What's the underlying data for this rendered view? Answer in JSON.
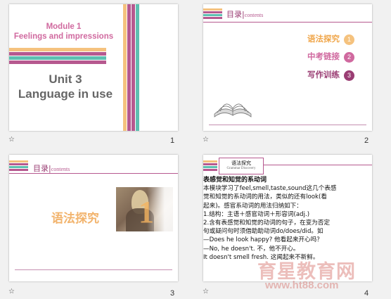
{
  "colors": {
    "orange": "#f5c27e",
    "pink": "#b6598f",
    "teal": "#5ebfb1",
    "purple": "#9a3d73",
    "gray": "#666666"
  },
  "slides": [
    {
      "number": "1",
      "icon": "star-icon",
      "module": "Module 1",
      "subtitle": "Feelings and impressions",
      "unit": "Unit 3",
      "unit_title": "Language in use"
    },
    {
      "number": "2",
      "icon": "star-icon",
      "toc_cn": "目录",
      "toc_en": "contents",
      "items": [
        {
          "label": "语法探究",
          "n": "1"
        },
        {
          "label": "中考链接",
          "n": "2"
        },
        {
          "label": "写作训练",
          "n": "3"
        }
      ]
    },
    {
      "number": "3",
      "icon": "star-icon",
      "toc_cn": "目录",
      "toc_en": "contents",
      "section": "语法探究",
      "section_num": "1"
    },
    {
      "number": "4",
      "icon": "star-icon",
      "tab_cn": "语法探究",
      "tab_en": "Grammar Discovery",
      "heading": "表感觉和知觉的系动词",
      "lines": [
        "本模块学习了feel,smell,taste,sound这几个表感",
        "觉和知觉的系动词的用法，类似的还有look(看",
        "起来)。感官系动词的用法归纳如下：",
        "1.结构：主语＋感官动词＋形容词(adj.)",
        "2.含有表感觉和知觉的动词的句子，在变为否定",
        "句或疑问句时须借助助动词do/does/did。如",
        "—Does he look happy? 他看起来开心吗？",
        "—No, he doesn't. 不，他不开心。",
        "It doesn't smell fresh. 这闻起来不新鲜。"
      ],
      "watermark": "育星教育网",
      "watermark_url": "www.ht88.com"
    }
  ]
}
